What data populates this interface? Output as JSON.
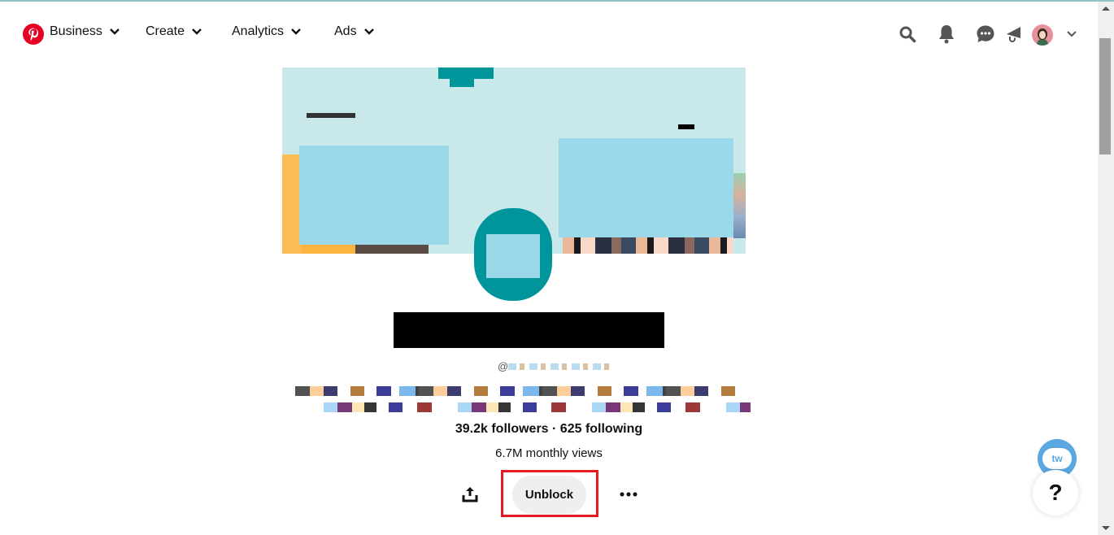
{
  "header": {
    "logo": "pinterest-logo",
    "nav": [
      {
        "label": "Business",
        "icon": "chevron-down-icon"
      },
      {
        "label": "Create",
        "icon": "chevron-down-icon"
      },
      {
        "label": "Analytics",
        "icon": "chevron-down-icon"
      },
      {
        "label": "Ads",
        "icon": "chevron-down-icon"
      }
    ],
    "icons": [
      "search-icon",
      "bell-icon",
      "message-icon",
      "megaphone-icon",
      "avatar",
      "chevron-down-icon"
    ]
  },
  "profile": {
    "name": "[redacted]",
    "handle_prefix": "@",
    "handle": "[redacted]",
    "bio": "[redacted]",
    "stats": "39.2k followers · 625 following",
    "views": "6.7M monthly views"
  },
  "actions": {
    "share_icon": "share-icon",
    "unblock_label": "Unblock",
    "more_icon": "more-icon"
  },
  "floating": {
    "tw_label": "tw",
    "help_label": "?"
  },
  "colors": {
    "brand": "#e60023",
    "highlight": "#e31b23",
    "cover_bg": "#c9e8ea",
    "profile_teal": "#00959b"
  }
}
